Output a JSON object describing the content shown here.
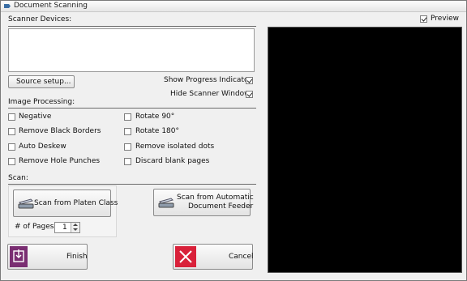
{
  "window": {
    "title": "Document Scanning"
  },
  "scanner": {
    "heading": "Scanner Devices:",
    "source_setup": "Source setup..."
  },
  "options": {
    "show_progress": {
      "label": "Show Progress Indicator",
      "checked": true
    },
    "hide_window": {
      "label": "Hide Scanner Window",
      "checked": true
    }
  },
  "image_processing": {
    "heading": "Image Processing:",
    "left": [
      "Negative",
      "Remove Black Borders",
      "Auto Deskew",
      "Remove Hole Punches"
    ],
    "right": [
      "Rotate 90°",
      "Rotate 180°",
      "Remove isolated dots",
      "Discard blank pages"
    ]
  },
  "scan": {
    "heading": "Scan:",
    "platen": "Scan from Platen Class",
    "adf_line1": "Scan from Automatic",
    "adf_line2": "Document Feeder",
    "pages_label": "# of Pages",
    "pages_value": "1"
  },
  "actions": {
    "finish": "Finish",
    "cancel": "Cancel"
  },
  "preview": {
    "label": "Preview",
    "checked": true
  },
  "colors": {
    "finish_icon": "#7a2e72",
    "cancel_icon": "#d9213a"
  }
}
